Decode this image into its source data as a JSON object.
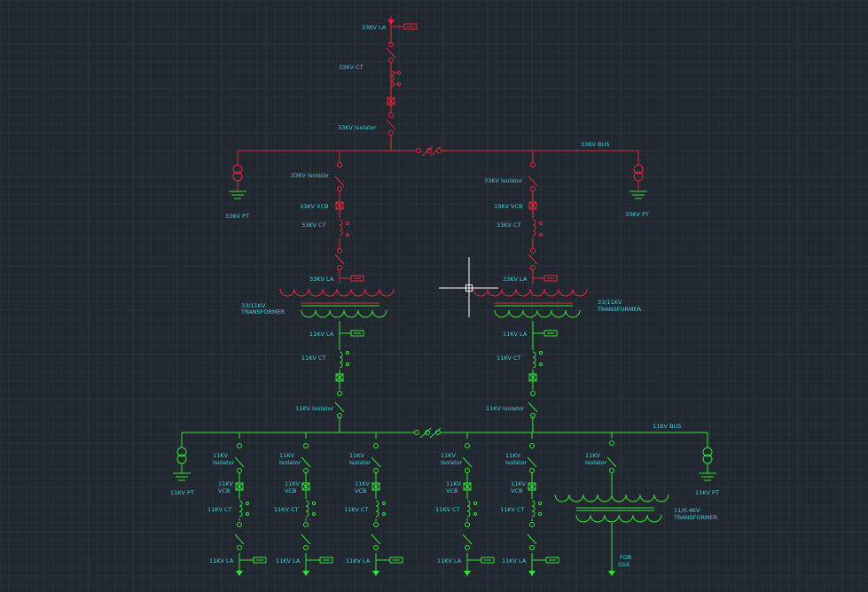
{
  "colors": {
    "background": "#212830",
    "grid_minor": "#2a323b",
    "grid_major": "#36404a",
    "hv_33kv": "#e8263a",
    "lv_11kv": "#35e23a",
    "label": "#3fd5e6",
    "cursor": "#ffffff"
  },
  "labels": {
    "incomer_la": "33KV LA",
    "incomer_ct": "33KV CT",
    "incomer_isolator": "33KV Isolator",
    "bus_33": "33KV BUS",
    "pt_33_left": "33KV PT",
    "pt_33_right": "33KV PT",
    "left_isolator": "33KV Isolator",
    "left_vcb": "33KV VCB",
    "left_ct": "33KV CT",
    "left_la": "33KV LA",
    "right_isolator": "33KV Isolator",
    "right_vcb": "33KV VCB",
    "right_ct": "33KV CT",
    "right_la": "33KV LA",
    "tr_left_line1": "33/11KV",
    "tr_left_line2": "TRANSFORMER",
    "tr_right_line1": "33/11KV",
    "tr_right_line2": "TRANSFORMER",
    "left_11_la": "11KV LA",
    "left_11_ct": "11KV CT",
    "left_11_isolator": "11KV Isolator",
    "right_11_la": "11KV LA",
    "right_11_ct": "11KV CT",
    "right_11_isolator": "11KV Isolator",
    "bus_11": "11KV BUS",
    "pt_11_left": "11KV PT",
    "pt_11_right": "11KV PT",
    "tr_lt_line1": "11/0.4KV",
    "tr_lt_line2": "TRANSFORMER",
    "for_line1": "FOR",
    "for_line2": "GSS"
  },
  "feeders": [
    {
      "iso1": "11KV",
      "iso2": "Isolator",
      "vcb1": "11KV",
      "vcb2": "VCB",
      "ct": "11KV CT",
      "la": "11KV LA"
    },
    {
      "iso1": "11KV",
      "iso2": "Isolator",
      "vcb1": "11KV",
      "vcb2": "VCB",
      "ct": "11KV CT",
      "la": "11KV LA"
    },
    {
      "iso1": "11KV",
      "iso2": "Isolator",
      "vcb1": "11KV",
      "vcb2": "VCB",
      "ct": "11KV CT",
      "la": "11KV LA"
    },
    {
      "iso1": "11KV",
      "iso2": "Isolator",
      "vcb1": "11KV",
      "vcb2": "VCB",
      "ct": "11KV CT",
      "la": "11KV LA"
    },
    {
      "iso1": "11KV",
      "iso2": "Isolator",
      "vcb1": "11KV",
      "vcb2": "VCB",
      "ct": "11KV CT",
      "la": "11KV LA"
    }
  ],
  "lt_feeder": {
    "iso1": "11KV",
    "iso2": "Isolator"
  }
}
